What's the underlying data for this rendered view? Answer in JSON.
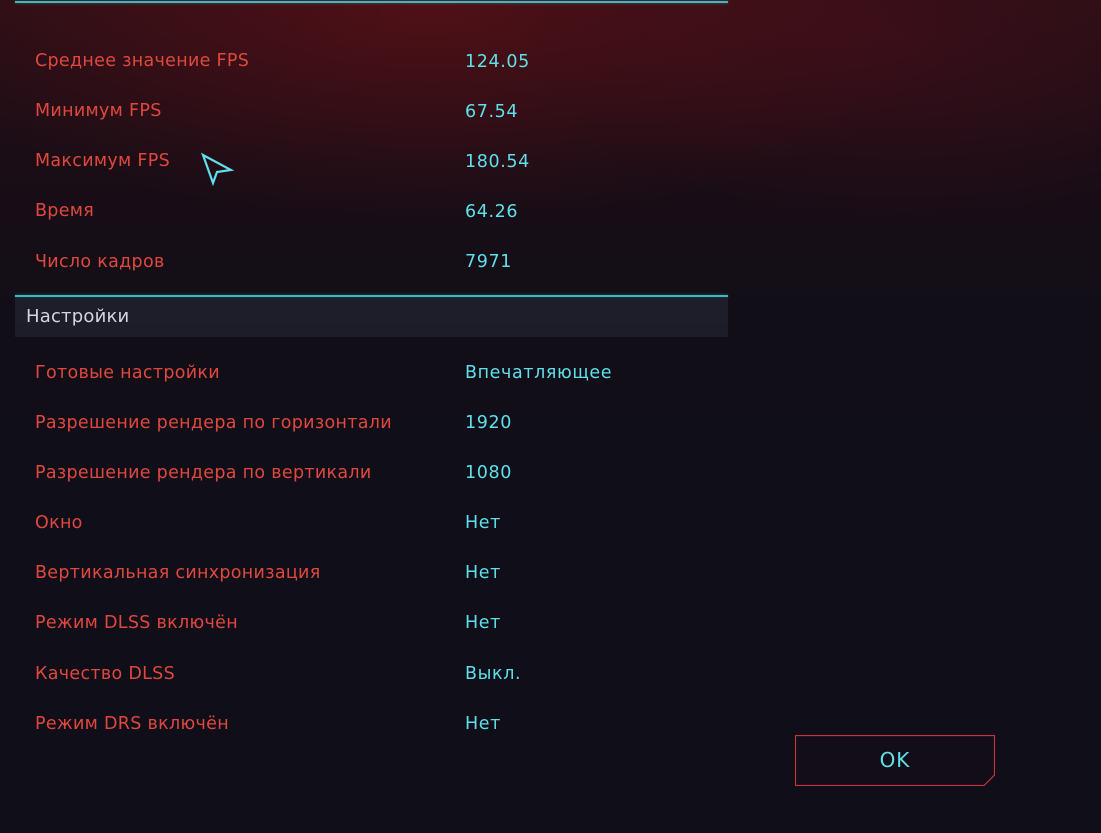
{
  "benchmark": {
    "rows": [
      {
        "label": "Среднее значение FPS",
        "value": "124.05"
      },
      {
        "label": "Минимум FPS",
        "value": "67.54"
      },
      {
        "label": "Максимум FPS",
        "value": "180.54"
      },
      {
        "label": "Время",
        "value": "64.26"
      },
      {
        "label": "Число кадров",
        "value": "7971"
      }
    ]
  },
  "settings": {
    "title": "Настройки",
    "rows": [
      {
        "label": "Готовые настройки",
        "value": "Впечатляющее"
      },
      {
        "label": "Разрешение рендера по горизонтали",
        "value": "1920"
      },
      {
        "label": "Разрешение рендера по вертикали",
        "value": "1080"
      },
      {
        "label": "Окно",
        "value": "Нет"
      },
      {
        "label": "Вертикальная синхронизация",
        "value": "Нет"
      },
      {
        "label": "Режим DLSS включён",
        "value": "Нет"
      },
      {
        "label": "Качество DLSS",
        "value": "Выкл."
      },
      {
        "label": "Режим DRS включён",
        "value": "Нет"
      }
    ]
  },
  "ok_button": {
    "label": "OK"
  },
  "colors": {
    "label": "#e0483e",
    "value": "#5fe0ea",
    "divider": "#3fb8bf",
    "button_border": "#c8343a"
  },
  "icons": {
    "cursor": "mouse-pointer-icon"
  }
}
